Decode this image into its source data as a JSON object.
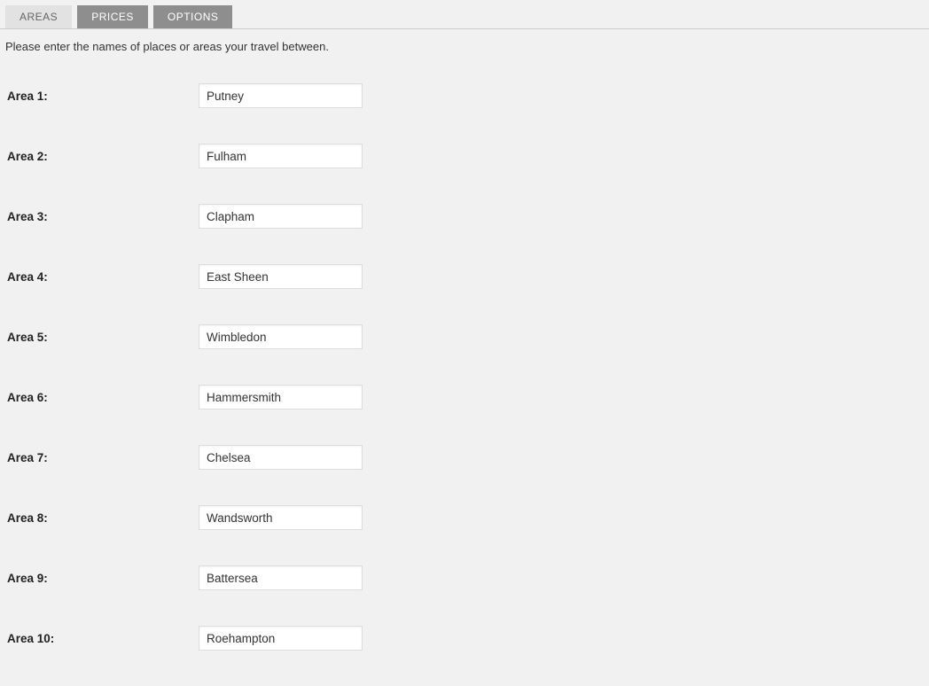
{
  "tabs": [
    {
      "label": "AREAS",
      "active": true
    },
    {
      "label": "PRICES",
      "active": false
    },
    {
      "label": "OPTIONS",
      "active": false
    }
  ],
  "description": "Please enter the names of places or areas your travel between.",
  "areas": [
    {
      "label": "Area 1:",
      "value": "Putney"
    },
    {
      "label": "Area 2:",
      "value": "Fulham"
    },
    {
      "label": "Area 3:",
      "value": "Clapham"
    },
    {
      "label": "Area 4:",
      "value": "East Sheen"
    },
    {
      "label": "Area 5:",
      "value": "Wimbledon"
    },
    {
      "label": "Area 6:",
      "value": "Hammersmith"
    },
    {
      "label": "Area 7:",
      "value": "Chelsea"
    },
    {
      "label": "Area 8:",
      "value": "Wandsworth"
    },
    {
      "label": "Area 9:",
      "value": "Battersea"
    },
    {
      "label": "Area 10:",
      "value": "Roehampton"
    }
  ]
}
